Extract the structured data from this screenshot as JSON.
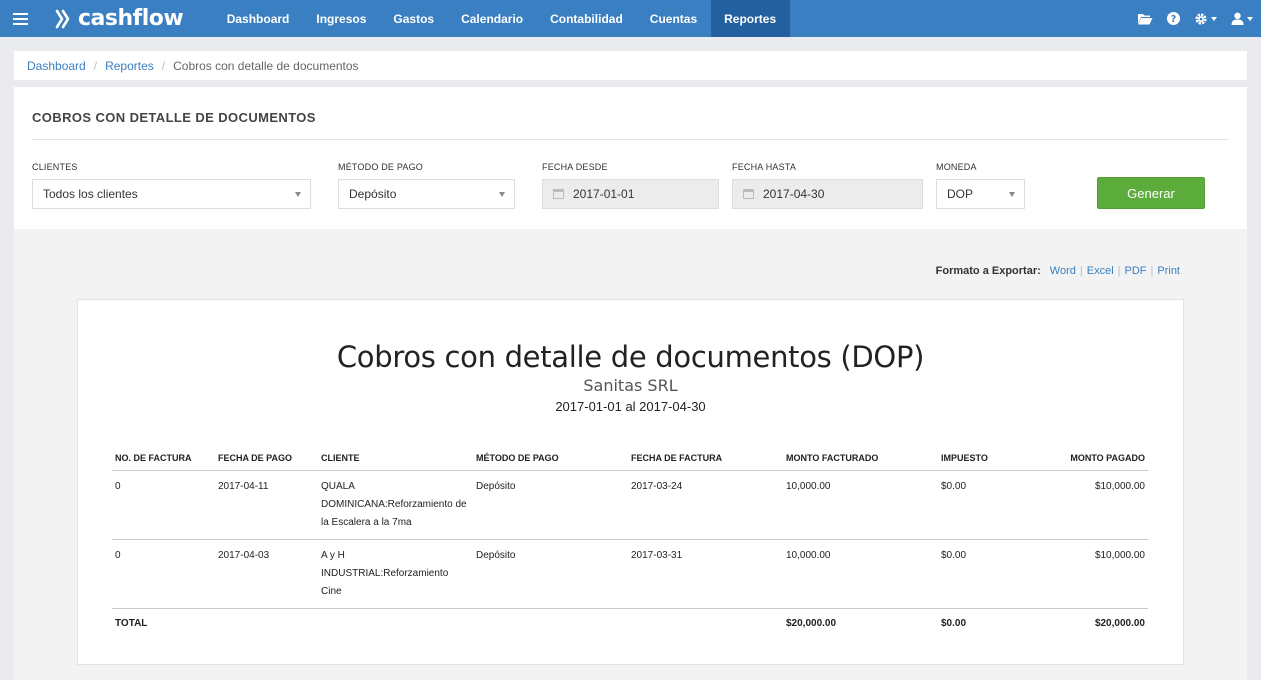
{
  "app": {
    "logo_text": "cashflow"
  },
  "nav": {
    "items": [
      "Dashboard",
      "Ingresos",
      "Gastos",
      "Calendario",
      "Contabilidad",
      "Cuentas",
      "Reportes"
    ],
    "active": "Reportes"
  },
  "breadcrumb": {
    "items": [
      "Dashboard",
      "Reportes"
    ],
    "current": "Cobros con detalle de documentos"
  },
  "page": {
    "title": "COBROS CON DETALLE DE DOCUMENTOS"
  },
  "filters": {
    "clientes": {
      "label": "CLIENTES",
      "value": "Todos los clientes"
    },
    "metodo": {
      "label": "MÉTODO DE PAGO",
      "value": "Depósito"
    },
    "desde": {
      "label": "FECHA DESDE",
      "value": "2017-01-01"
    },
    "hasta": {
      "label": "FECHA HASTA",
      "value": "2017-04-30"
    },
    "moneda": {
      "label": "MONEDA",
      "value": "DOP"
    },
    "generate_label": "Generar"
  },
  "export": {
    "label": "Formato a Exportar:",
    "options": [
      "Word",
      "Excel",
      "PDF",
      "Print"
    ]
  },
  "report": {
    "title": "Cobros con detalle de documentos (DOP)",
    "company": "Sanitas SRL",
    "range": "2017-01-01 al 2017-04-30",
    "columns": [
      "NO. DE FACTURA",
      "FECHA DE PAGO",
      "CLIENTE",
      "MÉTODO DE PAGO",
      "FECHA DE FACTURA",
      "MONTO FACTURADO",
      "IMPUESTO",
      "MONTO PAGADO"
    ],
    "rows": [
      [
        "0",
        "2017-04-11",
        "QUALA DOMINICANA:Reforzamiento de la Escalera a la 7ma",
        "Depósito",
        "2017-03-24",
        "10,000.00",
        "$0.00",
        "$10,000.00"
      ],
      [
        "0",
        "2017-04-03",
        "A y H INDUSTRIAL:Reforzamiento Cine",
        "Depósito",
        "2017-03-31",
        "10,000.00",
        "$0.00",
        "$10,000.00"
      ]
    ],
    "total": {
      "label": "TOTAL",
      "facturado": "$20,000.00",
      "impuesto": "$0.00",
      "pagado": "$20,000.00"
    }
  },
  "colors": {
    "topbar": "#3a7fc1",
    "active_nav": "#23609f",
    "link": "#3a7fc1",
    "generate": "#5cac3c"
  }
}
